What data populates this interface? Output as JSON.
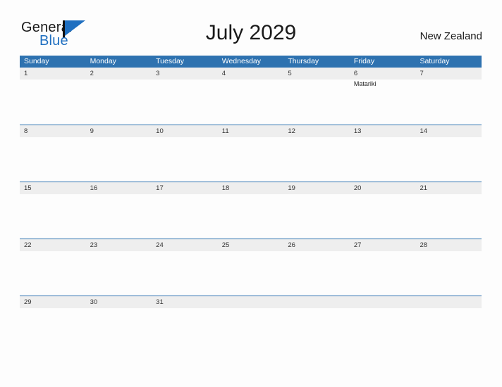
{
  "logo": {
    "word_one": "General",
    "word_two": "Blue",
    "flag_icon": "blue-triangle-flag",
    "blue_hex": "#1f6fc0"
  },
  "header": {
    "title": "July 2029",
    "region": "New Zealand"
  },
  "theme": {
    "header_blue": "#2e72b0",
    "band_gray": "#eeeeee",
    "page_background": "#fdfdfd",
    "text_dark": "#333333"
  },
  "calendar": {
    "month": "July",
    "year": "2029",
    "weekdays": [
      "Sunday",
      "Monday",
      "Tuesday",
      "Wednesday",
      "Thursday",
      "Friday",
      "Saturday"
    ],
    "weeks": [
      [
        {
          "num": "1",
          "event": ""
        },
        {
          "num": "2",
          "event": ""
        },
        {
          "num": "3",
          "event": ""
        },
        {
          "num": "4",
          "event": ""
        },
        {
          "num": "5",
          "event": ""
        },
        {
          "num": "6",
          "event": "Matariki"
        },
        {
          "num": "7",
          "event": ""
        }
      ],
      [
        {
          "num": "8",
          "event": ""
        },
        {
          "num": "9",
          "event": ""
        },
        {
          "num": "10",
          "event": ""
        },
        {
          "num": "11",
          "event": ""
        },
        {
          "num": "12",
          "event": ""
        },
        {
          "num": "13",
          "event": ""
        },
        {
          "num": "14",
          "event": ""
        }
      ],
      [
        {
          "num": "15",
          "event": ""
        },
        {
          "num": "16",
          "event": ""
        },
        {
          "num": "17",
          "event": ""
        },
        {
          "num": "18",
          "event": ""
        },
        {
          "num": "19",
          "event": ""
        },
        {
          "num": "20",
          "event": ""
        },
        {
          "num": "21",
          "event": ""
        }
      ],
      [
        {
          "num": "22",
          "event": ""
        },
        {
          "num": "23",
          "event": ""
        },
        {
          "num": "24",
          "event": ""
        },
        {
          "num": "25",
          "event": ""
        },
        {
          "num": "26",
          "event": ""
        },
        {
          "num": "27",
          "event": ""
        },
        {
          "num": "28",
          "event": ""
        }
      ],
      [
        {
          "num": "29",
          "event": ""
        },
        {
          "num": "30",
          "event": ""
        },
        {
          "num": "31",
          "event": ""
        },
        {
          "num": "",
          "event": ""
        },
        {
          "num": "",
          "event": ""
        },
        {
          "num": "",
          "event": ""
        },
        {
          "num": "",
          "event": ""
        }
      ]
    ]
  }
}
